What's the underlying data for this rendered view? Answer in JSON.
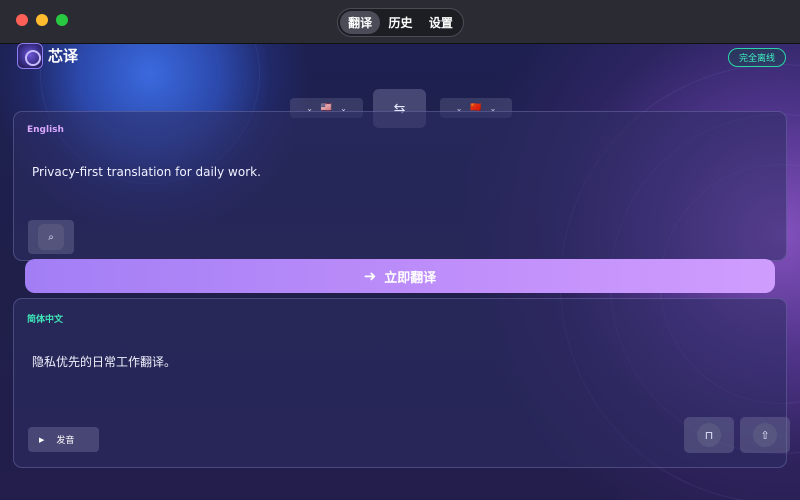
{
  "window": {
    "tabs": [
      {
        "label": "翻译",
        "active": true
      },
      {
        "label": "历史",
        "active": false
      },
      {
        "label": "设置",
        "active": false
      }
    ]
  },
  "app": {
    "title": "芯译",
    "offline_badge": "完全离线"
  },
  "languages": {
    "source_flag": "🇺🇸",
    "target_flag": "🇨🇳"
  },
  "source": {
    "label": "English",
    "text": "Privacy-first translation for daily work."
  },
  "translate_button": {
    "label": "立即翻译"
  },
  "target": {
    "label": "简体中文",
    "text": "隐私优先的日常工作翻译。",
    "speak_label": "发音"
  },
  "colors": {
    "accent": "#b48cfa",
    "source_label": "#d9a8ff",
    "target_label": "#3fe6b8",
    "offline_badge": "#3ff0c0"
  }
}
